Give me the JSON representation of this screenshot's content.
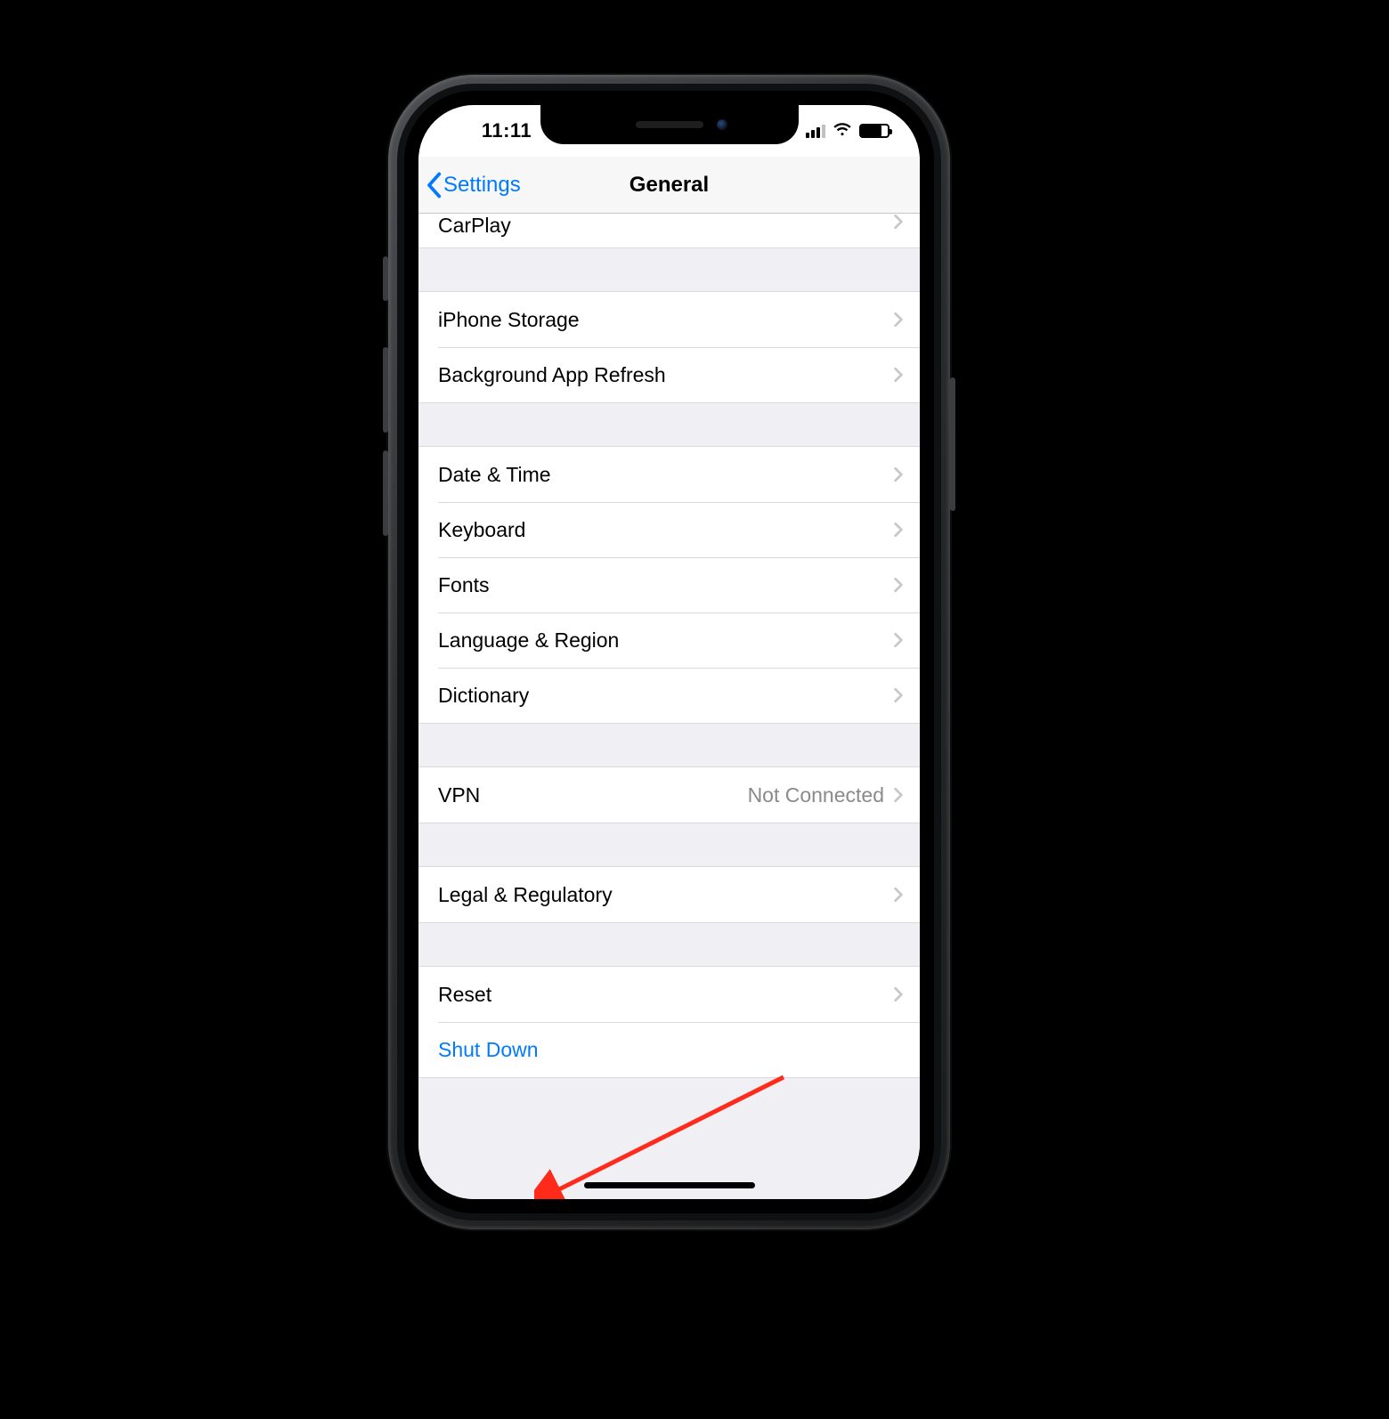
{
  "status": {
    "time": "11:11"
  },
  "nav": {
    "back_label": "Settings",
    "title": "General"
  },
  "groups": [
    {
      "rows": [
        {
          "id": "carplay",
          "label": "CarPlay"
        }
      ],
      "cut_top": true
    },
    {
      "rows": [
        {
          "id": "iphone-storage",
          "label": "iPhone Storage"
        },
        {
          "id": "background-app-refresh",
          "label": "Background App Refresh"
        }
      ]
    },
    {
      "rows": [
        {
          "id": "date-time",
          "label": "Date & Time"
        },
        {
          "id": "keyboard",
          "label": "Keyboard"
        },
        {
          "id": "fonts",
          "label": "Fonts"
        },
        {
          "id": "language-region",
          "label": "Language & Region"
        },
        {
          "id": "dictionary",
          "label": "Dictionary"
        }
      ]
    },
    {
      "rows": [
        {
          "id": "vpn",
          "label": "VPN",
          "detail": "Not Connected"
        }
      ]
    },
    {
      "rows": [
        {
          "id": "legal-regulatory",
          "label": "Legal & Regulatory"
        }
      ]
    },
    {
      "rows": [
        {
          "id": "reset",
          "label": "Reset"
        },
        {
          "id": "shut-down",
          "label": "Shut Down",
          "action": true
        }
      ]
    }
  ]
}
